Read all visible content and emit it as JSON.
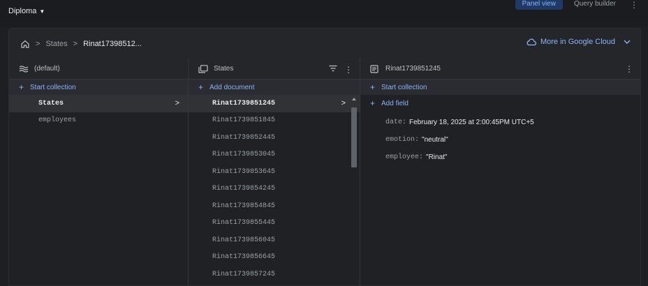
{
  "topbar": {
    "project": "Diploma",
    "tabs": [
      {
        "label": "Panel view",
        "active": true
      },
      {
        "label": "Query builder",
        "active": false
      }
    ]
  },
  "breadcrumb": {
    "items": [
      "States",
      "Rinat17398512..."
    ],
    "cloud_link": "More in Google Cloud"
  },
  "panel_root": {
    "title": "(default)",
    "action": "Start collection",
    "collections": [
      {
        "label": "States",
        "selected": true
      },
      {
        "label": "employees",
        "selected": false
      }
    ]
  },
  "panel_collection": {
    "title": "States",
    "action": "Add document",
    "documents": [
      {
        "label": "Rinat1739851245",
        "selected": true
      },
      {
        "label": "Rinat1739851845",
        "selected": false
      },
      {
        "label": "Rinat1739852445",
        "selected": false
      },
      {
        "label": "Rinat1739853045",
        "selected": false
      },
      {
        "label": "Rinat1739853645",
        "selected": false
      },
      {
        "label": "Rinat1739854245",
        "selected": false
      },
      {
        "label": "Rinat1739854845",
        "selected": false
      },
      {
        "label": "Rinat1739855445",
        "selected": false
      },
      {
        "label": "Rinat1739856045",
        "selected": false
      },
      {
        "label": "Rinat1739856645",
        "selected": false
      },
      {
        "label": "Rinat1739857245",
        "selected": false
      }
    ]
  },
  "panel_document": {
    "title": "Rinat1739851245",
    "action": "Start collection",
    "add_field": "Add field",
    "fields": [
      {
        "key": "date:",
        "value": "February 18, 2025 at 2:00:45PM UTC+5"
      },
      {
        "key": "emotion:",
        "value": "\"neutral\""
      },
      {
        "key": "employee:",
        "value": "\"Rinat\""
      }
    ]
  },
  "colors": {
    "accent": "#8ab4f8",
    "background": "#202124",
    "selected_row": "#303236"
  }
}
